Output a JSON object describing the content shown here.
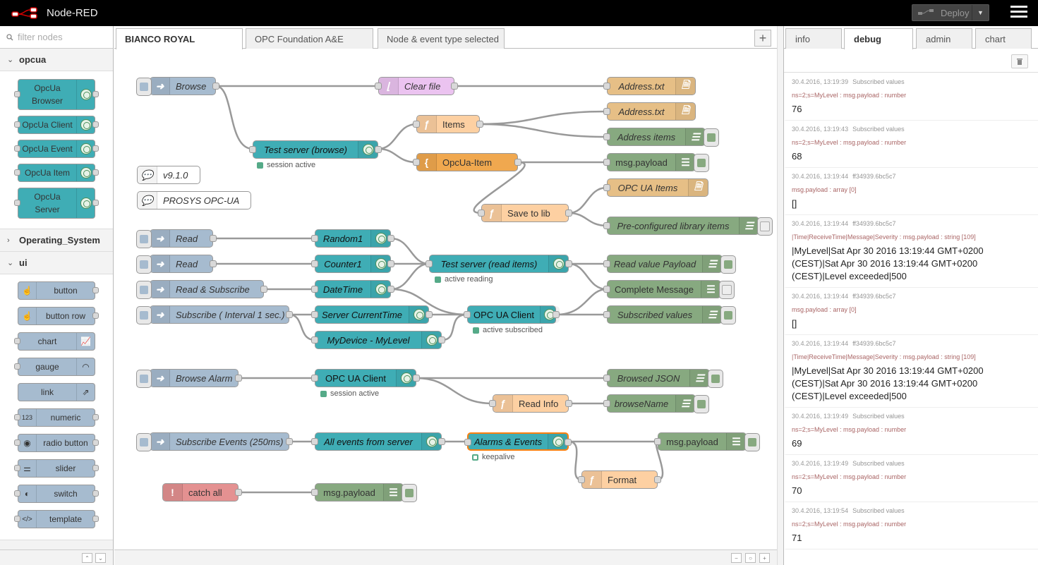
{
  "header": {
    "app_title": "Node-RED",
    "deploy_label": "Deploy"
  },
  "palette": {
    "filter_placeholder": "filter nodes",
    "categories": [
      {
        "name": "opcua",
        "expanded": true,
        "nodes": [
          "OpcUa Browser",
          "OpcUa Client",
          "OpcUa Event",
          "OpcUa Item",
          "OpcUa Server"
        ]
      },
      {
        "name": "Operating_System",
        "expanded": false
      },
      {
        "name": "ui",
        "expanded": true,
        "nodes": [
          "button",
          "button row",
          "chart",
          "gauge",
          "link",
          "numeric",
          "radio button",
          "slider",
          "switch",
          "template"
        ]
      }
    ]
  },
  "workspace": {
    "tabs": [
      "BIANCO ROYAL",
      "OPC Foundation A&E",
      "Node & event type selected"
    ],
    "active_tab": "BIANCO ROYAL",
    "add_tab": "+"
  },
  "flow": {
    "inject_browse": "Browse",
    "clear_file": "Clear file",
    "file_address1": "Address.txt",
    "file_address2": "Address.txt",
    "fn_items": "Items",
    "debug_address_items": "Address items",
    "test_server_browse": "Test server (browse)",
    "status_session_active1": "session active",
    "json_opcua_item": "OpcUa-Item",
    "debug_msg_payload1": "msg.payload",
    "comment_version": "v9.1.0",
    "comment_prosys": "PROSYS OPC-UA",
    "fn_save_to_lib": "Save to lib",
    "file_opcua_items": "OPC UA Items",
    "debug_preconfigured": "Pre-configured library items",
    "inject_read1": "Read",
    "inject_read2": "Read",
    "inject_read_subscribe": "Read & Subscribe",
    "inject_subscribe": "Subscribe ( Interval 1 sec.)",
    "item_random": "Random1",
    "item_counter": "Counter1",
    "item_datetime": "DateTime",
    "item_server_time": "Server CurrentTime",
    "item_mylevel": "MyDevice - MyLevel",
    "test_server_read": "Test server (read items)",
    "status_active_reading": "active reading",
    "opcua_client1": "OPC UA Client",
    "status_active_subscribed": "active subscribed",
    "debug_read_value": "Read value Payload",
    "debug_complete": "Complete Message",
    "debug_subscribed": "Subscribed values",
    "inject_browse_alarm": "Browse Alarm",
    "opcua_client2": "OPC UA Client",
    "status_session_active2": "session active",
    "debug_browsed_json": "Browsed JSON",
    "fn_read_info": "Read Info",
    "debug_browse_name": "browseName",
    "inject_subscribe_events": "Subscribe Events (250ms)",
    "item_all_events": "All events from server",
    "event_alarms": "Alarms & Events",
    "status_keepalive": "keepalive",
    "debug_msg_payload2": "msg.payload",
    "fn_format": "Format",
    "catch_all": "catch all",
    "debug_msg_payload3": "msg.payload"
  },
  "sidebar": {
    "tabs": [
      "info",
      "debug",
      "admin",
      "chart"
    ],
    "active_tab": "debug",
    "messages": [
      {
        "time": "30.4.2016, 13:19:39",
        "node": "Subscribed values",
        "topic": "ns=2;s=MyLevel : msg.payload : number",
        "payload": "76"
      },
      {
        "time": "30.4.2016, 13:19:43",
        "node": "Subscribed values",
        "topic": "ns=2;s=MyLevel : msg.payload : number",
        "payload": "68"
      },
      {
        "time": "30.4.2016, 13:19:44",
        "node": "ff34939.6bc5c7",
        "topic": "msg.payload : array [0]",
        "payload": "[]"
      },
      {
        "time": "30.4.2016, 13:19:44",
        "node": "ff34939.6bc5c7",
        "topic": "|Time|ReceiveTime|Message|Severity : msg.payload : string [109]",
        "payload": "|MyLevel|Sat Apr 30 2016 13:19:44 GMT+0200 (CEST)|Sat Apr 30 2016 13:19:44 GMT+0200 (CEST)|Level exceeded|500"
      },
      {
        "time": "30.4.2016, 13:19:44",
        "node": "ff34939.6bc5c7",
        "topic": "msg.payload : array [0]",
        "payload": "[]"
      },
      {
        "time": "30.4.2016, 13:19:44",
        "node": "ff34939.6bc5c7",
        "topic": "|Time|ReceiveTime|Message|Severity : msg.payload : string [109]",
        "payload": "|MyLevel|Sat Apr 30 2016 13:19:44 GMT+0200 (CEST)|Sat Apr 30 2016 13:19:44 GMT+0200 (CEST)|Level exceeded|500"
      },
      {
        "time": "30.4.2016, 13:19:49",
        "node": "Subscribed values",
        "topic": "ns=2;s=MyLevel : msg.payload : number",
        "payload": "69"
      },
      {
        "time": "30.4.2016, 13:19:49",
        "node": "Subscribed values",
        "topic": "ns=2;s=MyLevel : msg.payload : number",
        "payload": "70"
      },
      {
        "time": "30.4.2016, 13:19:54",
        "node": "Subscribed values",
        "topic": "ns=2;s=MyLevel : msg.payload : number",
        "payload": "71"
      }
    ]
  },
  "colors": {
    "accent": "#ff7f0e",
    "teal": "#3fadb5",
    "inject": "#a6bbcf",
    "debug": "#87a980"
  }
}
